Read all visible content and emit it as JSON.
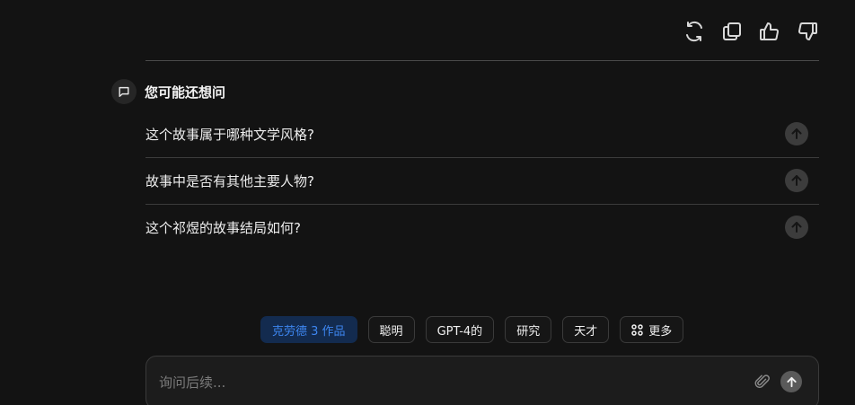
{
  "actions": [
    {
      "icon": "refresh-icon"
    },
    {
      "icon": "copy-icon"
    },
    {
      "icon": "thumbs-up-icon"
    },
    {
      "icon": "thumbs-down-icon"
    }
  ],
  "related": {
    "icon": "chat-bubble-icon",
    "title": "您可能还想问",
    "questions": [
      {
        "text": "这个故事属于哪种文学风格?",
        "icon": "arrow-up-icon"
      },
      {
        "text": "故事中是否有其他主要人物?",
        "icon": "arrow-up-icon"
      },
      {
        "text": "这个祁煜的故事结局如何?",
        "icon": "arrow-up-icon"
      }
    ]
  },
  "chips": [
    {
      "label": "克劳德 3 作品",
      "active": true
    },
    {
      "label": "聪明",
      "active": false
    },
    {
      "label": "GPT-4的",
      "active": false
    },
    {
      "label": "研究",
      "active": false
    },
    {
      "label": "天才",
      "active": false
    },
    {
      "label": "更多",
      "active": false,
      "icon": "grid-icon"
    }
  ],
  "input": {
    "placeholder": "询问后续...",
    "value": "",
    "attach_icon": "paperclip-icon",
    "send_icon": "arrow-up-icon"
  },
  "colors": {
    "background": "#131313",
    "accent_chip_bg": "#132b4f",
    "accent_chip_text": "#3d86f0"
  }
}
